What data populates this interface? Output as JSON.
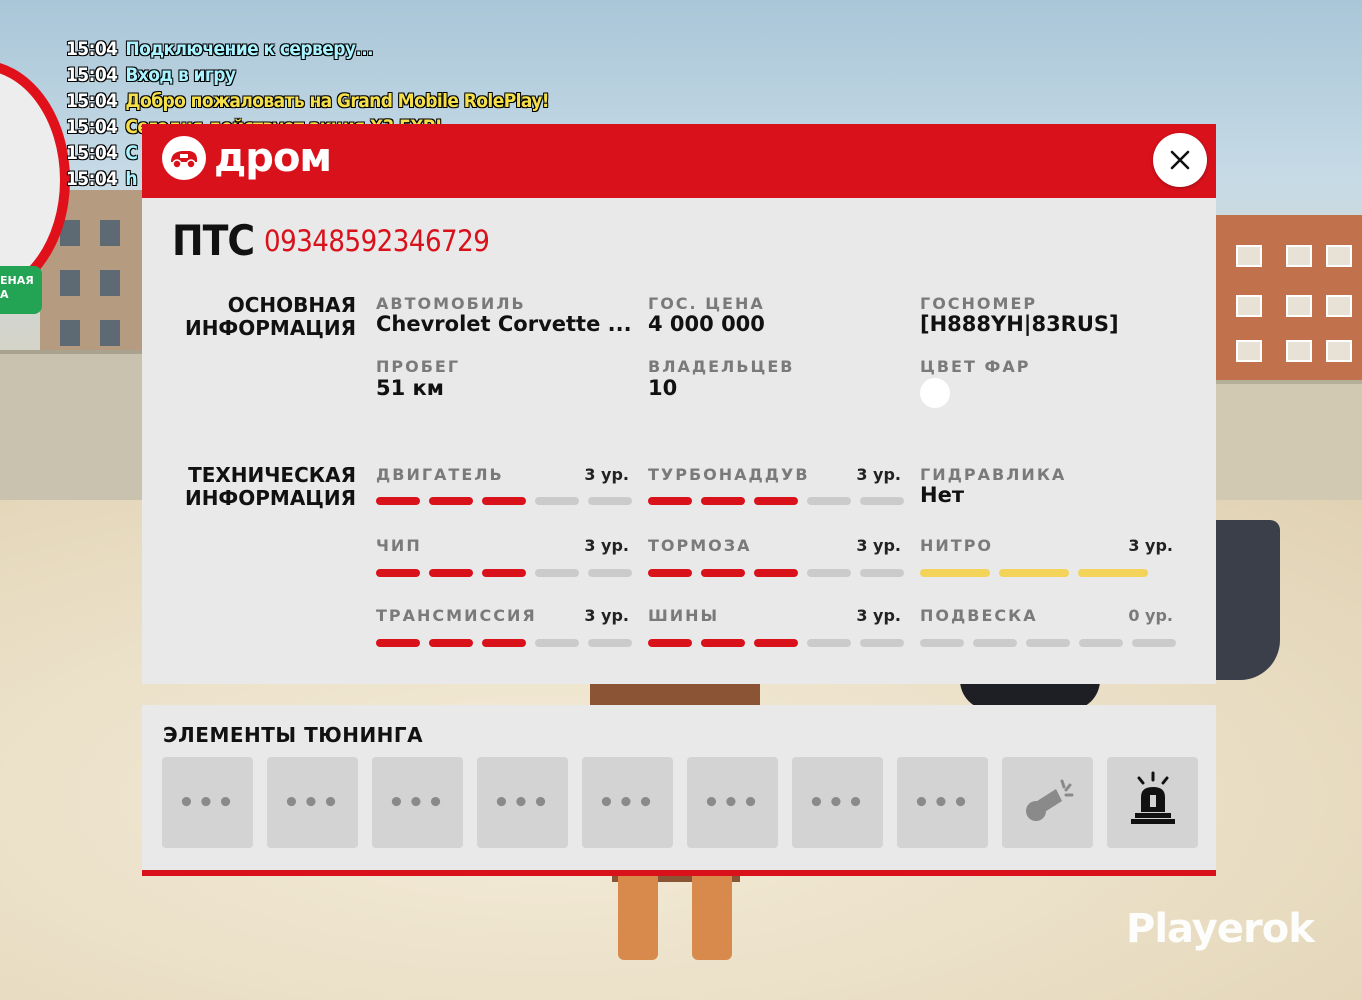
{
  "chat": [
    {
      "time": "15:04",
      "text": "Подключение к серверу...",
      "color": "#a8f3ff"
    },
    {
      "time": "15:04",
      "text": "Вход в игру",
      "color": "#a8f3ff"
    },
    {
      "time": "15:04",
      "text": "Добро пожаловать на Grand Mobile RolePlay!",
      "color": "#f6e04a"
    },
    {
      "time": "15:04",
      "text": "Сегодня действует акция Х3 EXP!",
      "color": "#f6e04a"
    },
    {
      "time": "15:04",
      "text": "С",
      "color": "#a8f3ff"
    },
    {
      "time": "15:04",
      "text": "h",
      "color": "#a8f3ff"
    }
  ],
  "side_tag": "ЕНАЯ\nА",
  "header": {
    "logo_text": "дром",
    "close_icon": "close-icon"
  },
  "pts": {
    "label": "ПТС",
    "number": "09348592346729"
  },
  "main_info": {
    "title_line1": "ОСНОВНАЯ",
    "title_line2": "ИНФОРМАЦИЯ",
    "car_label": "АВТОМОБИЛЬ",
    "car_value": "Chevrolet Corvette ...",
    "price_label": "ГОС. ЦЕНА",
    "price_value": "4 000 000",
    "plate_label": "ГОСНОМЕР",
    "plate_value": "[H888YH|83RUS]",
    "mileage_label": "ПРОБЕГ",
    "mileage_value": "51 км",
    "owners_label": "ВЛАДЕЛЬЦЕВ",
    "owners_value": "10",
    "lights_label": "ЦВЕТ ФАР",
    "lights_color": "#ffffff"
  },
  "tech_info": {
    "title_line1": "ТЕХНИЧЕСКАЯ",
    "title_line2": "ИНФОРМАЦИЯ",
    "engine": {
      "label": "ДВИГАТЕЛЬ",
      "level_text": "3 ур.",
      "level": 3,
      "max": 5
    },
    "turbo": {
      "label": "ТУРБОНАДДУВ",
      "level_text": "3 ур.",
      "level": 3,
      "max": 5
    },
    "hydraulics": {
      "label": "ГИДРАВЛИКА",
      "value": "Нет"
    },
    "chip": {
      "label": "ЧИП",
      "level_text": "3 ур.",
      "level": 3,
      "max": 5
    },
    "brakes": {
      "label": "ТОРМОЗА",
      "level_text": "3 ур.",
      "level": 3,
      "max": 5
    },
    "nitro": {
      "label": "НИТРО",
      "level_text": "3 ур.",
      "level": 3,
      "max": 3
    },
    "transmission": {
      "label": "ТРАНСМИССИЯ",
      "level_text": "3 ур.",
      "level": 3,
      "max": 5
    },
    "tires": {
      "label": "ШИНЫ",
      "level_text": "3 ур.",
      "level": 3,
      "max": 5
    },
    "suspension": {
      "label": "ПОДВЕСКА",
      "level_text": "0 ур.",
      "level": 0,
      "max": 5
    }
  },
  "tuning": {
    "title": "ЭЛЕМЕНТЫ ТЮНИНГА",
    "slots": [
      "•••",
      "•••",
      "•••",
      "•••",
      "•••",
      "•••",
      "•••",
      "•••",
      "horn-icon",
      "siren-icon"
    ]
  },
  "watermark": "Playerok",
  "colors": {
    "accent": "#d8111b",
    "nitro": "#f3d35a",
    "inactive": "#cbcbcb"
  }
}
